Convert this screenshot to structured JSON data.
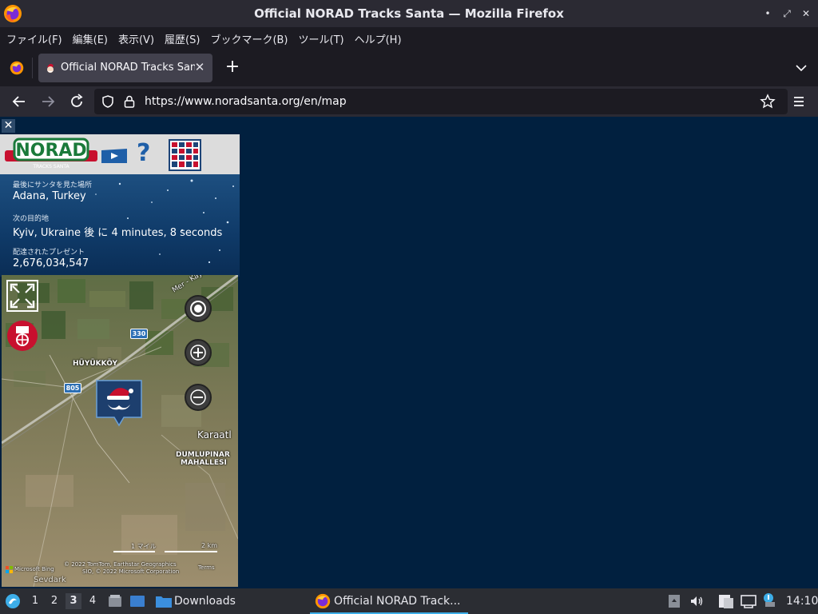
{
  "window": {
    "title": "Official NORAD Tracks Santa — Mozilla Firefox"
  },
  "menubar": {
    "items": [
      "ファイル(F)",
      "編集(E)",
      "表示(V)",
      "履歴(S)",
      "ブックマーク(B)",
      "ツール(T)",
      "ヘルプ(H)"
    ]
  },
  "tab": {
    "label": "Official NORAD Tracks Santa"
  },
  "navbar": {
    "url": "https://www.noradsanta.org/en/map"
  },
  "panel": {
    "logo_text": "NORAD",
    "logo_sub": "TRACKS SANTA",
    "last_seen_label": "最後にサンタを見た場所",
    "last_seen_value": "Adana, Turkey",
    "next_dest_label": "次の目的地",
    "next_dest_value": "Kyiv, Ukraine 後 に 4 minutes, 8 seconds",
    "gifts_label": "配達されたプレゼント",
    "gifts_value": "2,676,034,547"
  },
  "map": {
    "road_330": "330",
    "road_805": "805",
    "place_huyukkoy": "HÜYÜKKÖY",
    "place_karaat": "Karaatl",
    "place_dumlupinar_1": "DUMLUPINAR",
    "place_dumlupinar_2": "MAHALLESI",
    "road_name": "Mer - Kayseri Yo",
    "scale_miles": "1 マイル",
    "scale_km": "2 km",
    "attribution_1": "© 2022 TomTom, Earthstar Geographics",
    "attribution_2": "SIO, © 2022 Microsoft Corporation",
    "terms": "Terms",
    "bing": "Microsoft Bing",
    "place_bottom": "Sevdark"
  },
  "taskbar": {
    "workspaces": [
      "1",
      "2",
      "3",
      "4"
    ],
    "active_workspace": "3",
    "downloads_label": "Downloads",
    "task_label": "Official NORAD Track...",
    "clock": "14:10"
  },
  "colors": {
    "content_bg": "#01203f",
    "accent": "#3daee9"
  }
}
